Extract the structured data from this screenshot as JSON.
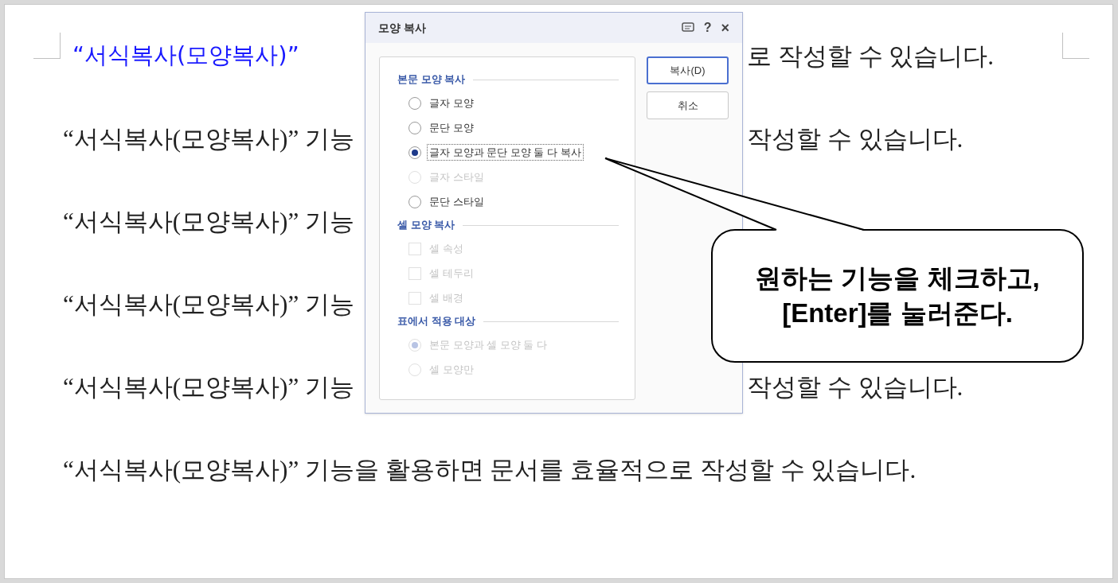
{
  "document": {
    "lines": [
      {
        "kind": "split",
        "left": "“서식복사(모양복사)”",
        "left_highlight": true,
        "right": "로 작성할 수 있습니다."
      },
      {
        "kind": "split",
        "left": "“서식복사(모양복사)” 기능",
        "left_highlight": false,
        "right": "작성할 수 있습니다."
      },
      {
        "kind": "split",
        "left": "“서식복사(모양복사)” 기능",
        "left_highlight": false
      },
      {
        "kind": "split",
        "left": "“서식복사(모양복사)” 기능",
        "left_highlight": false
      },
      {
        "kind": "split",
        "left": "“서식복사(모양복사)” 기능",
        "left_highlight": false,
        "right": "작성할 수 있습니다."
      },
      {
        "kind": "full",
        "text": "“서식복사(모양복사)” 기능을 활용하면 문서를 효율적으로 작성할 수 있습니다."
      }
    ]
  },
  "dialog": {
    "title": "모양 복사",
    "help": "?",
    "close": "×",
    "sections": [
      {
        "title": "본문 모양 복사",
        "items": [
          {
            "kind": "radio",
            "label": "글자 모양",
            "selected": false,
            "disabled": false,
            "focused": false
          },
          {
            "kind": "radio",
            "label": "문단 모양",
            "selected": false,
            "disabled": false,
            "focused": false
          },
          {
            "kind": "radio",
            "label": "글자 모양과 문단 모양 둘 다 복사",
            "selected": true,
            "disabled": false,
            "focused": true
          },
          {
            "kind": "radio",
            "label": "글자 스타일",
            "selected": false,
            "disabled": true,
            "focused": false
          },
          {
            "kind": "radio",
            "label": "문단 스타일",
            "selected": false,
            "disabled": false,
            "focused": false
          }
        ]
      },
      {
        "title": "셀 모양 복사",
        "items": [
          {
            "kind": "checkbox",
            "label": "셀 속성",
            "checked": false,
            "disabled": true,
            "focused": false
          },
          {
            "kind": "checkbox",
            "label": "셀 테두리",
            "checked": false,
            "disabled": true,
            "focused": false
          },
          {
            "kind": "checkbox",
            "label": "셀 배경",
            "checked": false,
            "disabled": true,
            "focused": false
          }
        ]
      },
      {
        "title": "표에서 적용 대상",
        "items": [
          {
            "kind": "radio",
            "label": "본문 모양과 셀 모양 둘 다",
            "selected": true,
            "disabled": true,
            "focused": false
          },
          {
            "kind": "radio",
            "label": "셀 모양만",
            "selected": false,
            "disabled": true,
            "focused": false
          }
        ]
      }
    ],
    "buttons": [
      {
        "label": "복사(D)",
        "default": true
      },
      {
        "label": "취소",
        "default": false
      }
    ]
  },
  "callout": {
    "lines": [
      "원하는 기능을 체크하고,",
      "[Enter]를 눌러준다."
    ]
  }
}
